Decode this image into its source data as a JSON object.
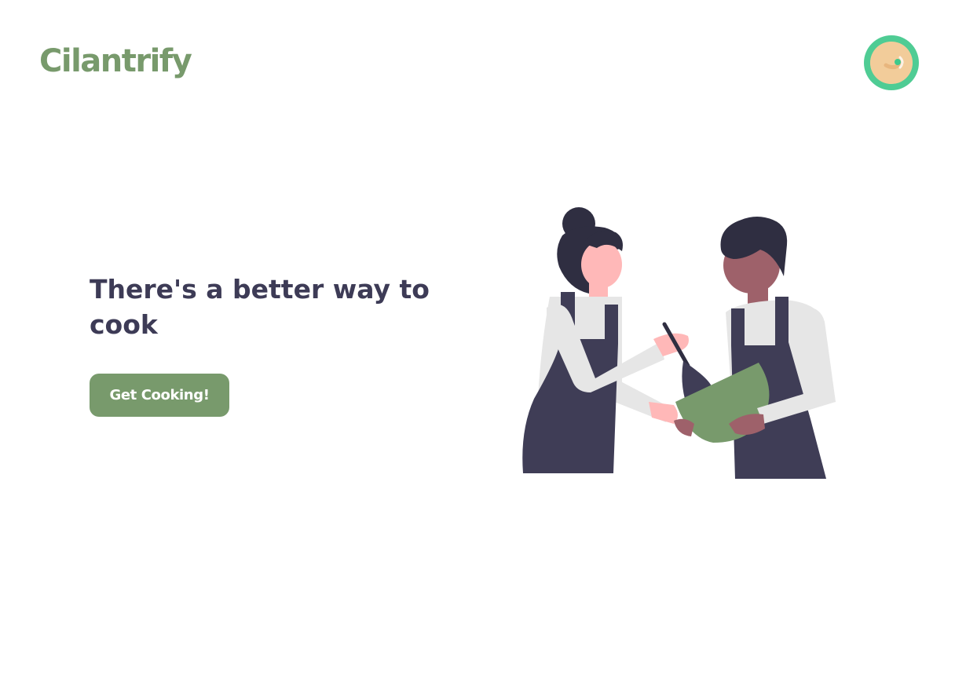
{
  "header": {
    "brand": "Cilantrify",
    "avatar_icon": "user-avatar-icon"
  },
  "hero": {
    "title": "There's a better way to cook",
    "cta_label": "Get Cooking!",
    "illustration": "two-chefs-cooking-illustration"
  },
  "colors": {
    "brand": "#789a6c",
    "text": "#3d3b56",
    "avatar_ring": "#4fcc94",
    "avatar_fill": "#f2cc9a",
    "background": "#ffffff"
  }
}
